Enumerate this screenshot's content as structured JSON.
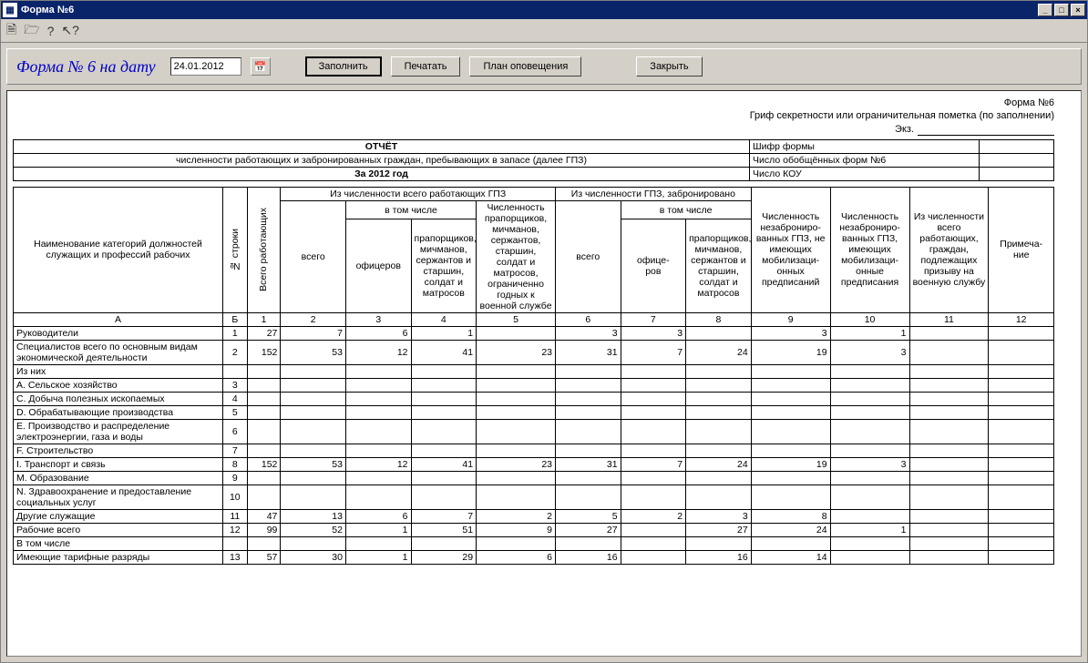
{
  "window": {
    "title": "Форма №6"
  },
  "toolbar_icons": [
    "save",
    "open",
    "help",
    "pointer"
  ],
  "panel": {
    "title": "Форма № 6 на дату",
    "date": "24.01.2012",
    "buttons": {
      "fill": "Заполнить",
      "print": "Печатать",
      "plan": "План оповещения",
      "close": "Закрыть"
    }
  },
  "meta": {
    "form_no": "Форма №6",
    "secrecy": "Гриф секретности или ограничительная пометка (по заполнении)",
    "ekz": "Экз."
  },
  "meta_side": {
    "shifr": "Шифр формы",
    "count6": "Число обобщённых форм №6",
    "kou": "Число КОУ"
  },
  "report": {
    "title": "ОТЧЁТ",
    "subtitle": "численности работающих и забронированных граждан, пребывающих в запасе (далее ГПЗ)",
    "year": "За 2012 год"
  },
  "headers": {
    "name": "Наименование категорий должностей служащих и профессий рабочих",
    "row_no": "№ строки",
    "total_work": "Всего работающих",
    "grp1": "Из численности всего работающих ГПЗ",
    "grp2": "Из численности ГПЗ, забронировано",
    "vtom": "в том числе",
    "vsego": "всего",
    "oficer": "офицеров",
    "oficer2": "офице-\nров",
    "prapor": "прапорщиков, мичманов, сержантов и старшин, солдат и матросов",
    "limited": "Численность прапорщиков, мичманов, сержантов, старшин, солдат и матросов, ограниченно годных к военной службе",
    "nez_no": "Численность незаброниро-\nванных ГПЗ, не имеющих мобилизаци-\nонных предписаний",
    "nez_yes": "Численность незаброниро-\nванных ГПЗ, имеющих мобилизаци-\nонные предписания",
    "prizyv": "Из численности всего работающих, граждан, подлежащих призыву на военную службу",
    "note": "Примеча-\nние",
    "A": "А",
    "B": "Б",
    "n1": "1",
    "n2": "2",
    "n3": "3",
    "n4": "4",
    "n5": "5",
    "n6": "6",
    "n7": "7",
    "n8": "8",
    "n9": "9",
    "n10": "10",
    "n11": "11",
    "n12": "12"
  },
  "rows": [
    {
      "name": "Руководители",
      "l": 1,
      "b": "1",
      "v": [
        "27",
        "7",
        "6",
        "1",
        "",
        "3",
        "3",
        "",
        "3",
        "1",
        "",
        ""
      ]
    },
    {
      "name": "Специалистов всего по основным видам экономической деятельности",
      "l": 0,
      "b": "2",
      "v": [
        "152",
        "53",
        "12",
        "41",
        "23",
        "31",
        "7",
        "24",
        "19",
        "3",
        "",
        ""
      ]
    },
    {
      "name": "Из них",
      "l": 0,
      "b": "",
      "v": [
        "",
        "",
        "",
        "",
        "",
        "",
        "",
        "",
        "",
        "",
        "",
        ""
      ]
    },
    {
      "name": "A. Сельское хозяйство",
      "l": 1,
      "b": "3",
      "v": [
        "",
        "",
        "",
        "",
        "",
        "",
        "",
        "",
        "",
        "",
        "",
        ""
      ]
    },
    {
      "name": "C. Добыча полезных ископаемых",
      "l": 1,
      "b": "4",
      "v": [
        "",
        "",
        "",
        "",
        "",
        "",
        "",
        "",
        "",
        "",
        "",
        ""
      ]
    },
    {
      "name": "D. Обрабатывающие производства",
      "l": 1,
      "b": "5",
      "v": [
        "",
        "",
        "",
        "",
        "",
        "",
        "",
        "",
        "",
        "",
        "",
        ""
      ]
    },
    {
      "name": "E. Производство и распределение электроэнергии, газа и воды",
      "l": 1,
      "b": "6",
      "v": [
        "",
        "",
        "",
        "",
        "",
        "",
        "",
        "",
        "",
        "",
        "",
        ""
      ]
    },
    {
      "name": "F. Строительство",
      "l": 1,
      "b": "7",
      "v": [
        "",
        "",
        "",
        "",
        "",
        "",
        "",
        "",
        "",
        "",
        "",
        ""
      ]
    },
    {
      "name": "I. Транспорт и связь",
      "l": 1,
      "b": "8",
      "v": [
        "152",
        "53",
        "12",
        "41",
        "23",
        "31",
        "7",
        "24",
        "19",
        "3",
        "",
        ""
      ]
    },
    {
      "name": "M. Образование",
      "l": 1,
      "b": "9",
      "v": [
        "",
        "",
        "",
        "",
        "",
        "",
        "",
        "",
        "",
        "",
        "",
        ""
      ]
    },
    {
      "name": "N. Здравоохранение и предоставление социальных услуг",
      "l": 1,
      "b": "10",
      "v": [
        "",
        "",
        "",
        "",
        "",
        "",
        "",
        "",
        "",
        "",
        "",
        ""
      ]
    },
    {
      "name": "Другие служащие",
      "l": 0,
      "b": "11",
      "v": [
        "47",
        "13",
        "6",
        "7",
        "2",
        "5",
        "2",
        "3",
        "8",
        "",
        "",
        ""
      ]
    },
    {
      "name": "Рабочие всего",
      "l": 0,
      "b": "12",
      "v": [
        "99",
        "52",
        "1",
        "51",
        "9",
        "27",
        "",
        "27",
        "24",
        "1",
        "",
        ""
      ]
    },
    {
      "name": "В том числе",
      "l": 0,
      "b": "",
      "v": [
        "",
        "",
        "",
        "",
        "",
        "",
        "",
        "",
        "",
        "",
        "",
        ""
      ]
    },
    {
      "name": "Имеющие тарифные разряды",
      "l": 1,
      "b": "13",
      "v": [
        "57",
        "30",
        "1",
        "29",
        "6",
        "16",
        "",
        "16",
        "14",
        "",
        "",
        ""
      ]
    }
  ]
}
